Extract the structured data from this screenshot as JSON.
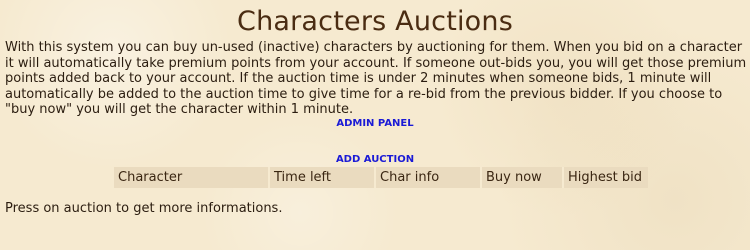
{
  "page": {
    "title": "Characters Auctions",
    "intro": "With this system you can buy un-used (inactive) characters by auctioning for them. When you bid on a character it will automatically take premium points from your account. If someone out-bids you, you will get those premium points added back to your account. If the auction time is under 2 minutes when someone bids, 1 minute will automatically be added to the auction time to give time for a re-bid from the previous bidder. If you choose to \"buy now\" you will get the character within 1 minute.",
    "admin_panel_label": "ADMIN PANEL",
    "add_auction_label": "ADD AUCTION",
    "footer_text": "Press on auction to get more informations."
  },
  "table": {
    "columns": [
      "Character",
      "Time left",
      "Char info",
      "Buy now",
      "Highest bid"
    ]
  },
  "colors": {
    "background": "#f6ead0",
    "link": "#1a1ad6",
    "header_bg": "#eadbbf",
    "title": "#4a2c12"
  }
}
